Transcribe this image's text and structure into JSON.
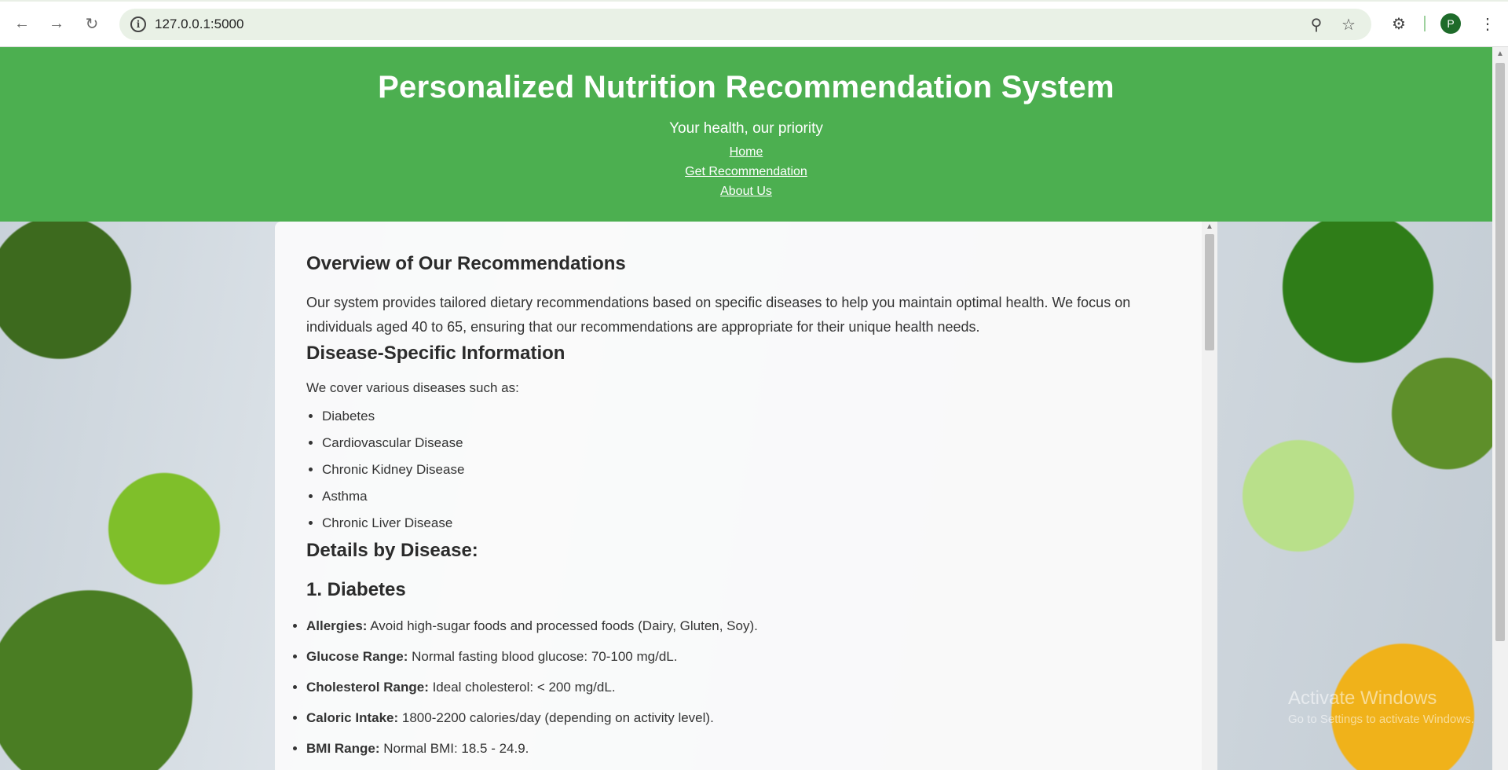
{
  "browser": {
    "url": "127.0.0.1:5000",
    "avatar_letter": "P"
  },
  "header": {
    "title": "Personalized Nutrition Recommendation System",
    "tagline": "Your health, our priority",
    "nav": [
      "Home",
      "Get Recommendation",
      "About Us"
    ]
  },
  "content": {
    "overview_heading": "Overview of Our Recommendations",
    "overview_text": "Our system provides tailored dietary recommendations based on specific diseases to help you maintain optimal health. We focus on individuals aged 40 to 65, ensuring that our recommendations are appropriate for their unique health needs.",
    "disease_heading": "Disease-Specific Information",
    "disease_intro": "We cover various diseases such as:",
    "diseases": [
      "Diabetes",
      "Cardiovascular Disease",
      "Chronic Kidney Disease",
      "Asthma",
      "Chronic Liver Disease"
    ],
    "details_heading": "Details by Disease:",
    "diabetes_heading": "1. Diabetes",
    "diabetes_details": [
      {
        "label": "Allergies:",
        "text": " Avoid high-sugar foods and processed foods (Dairy, Gluten, Soy)."
      },
      {
        "label": "Glucose Range:",
        "text": " Normal fasting blood glucose: 70-100 mg/dL."
      },
      {
        "label": "Cholesterol Range:",
        "text": " Ideal cholesterol: < 200 mg/dL."
      },
      {
        "label": "Caloric Intake:",
        "text": " 1800-2200 calories/day (depending on activity level)."
      },
      {
        "label": "BMI Range:",
        "text": " Normal BMI: 18.5 - 24.9."
      }
    ]
  },
  "watermark": {
    "title": "Activate Windows",
    "subtitle": "Go to Settings to activate Windows."
  },
  "colors": {
    "header_green": "#4caf50",
    "avatar_green": "#1e6b2a"
  }
}
